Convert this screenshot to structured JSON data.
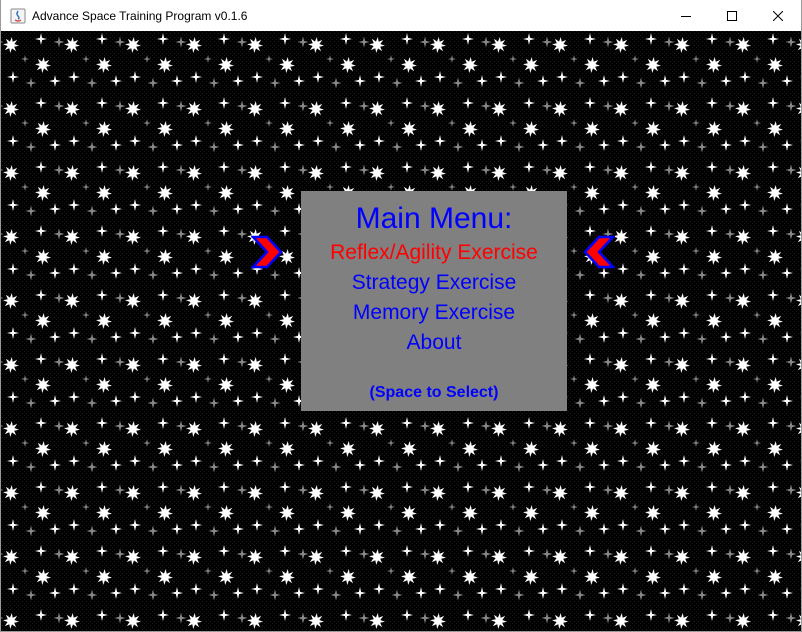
{
  "window": {
    "title": "Advance Space Training Program v0.1.6",
    "icon": "java-app-icon",
    "controls": [
      "minimize-icon",
      "maximize-icon",
      "close-icon"
    ]
  },
  "background": {
    "pattern": "tiled starfield",
    "color": "#000000",
    "star_color_bright": "#ffffff",
    "star_color_dim": "#888888"
  },
  "menu": {
    "title": "Main Menu:",
    "items": [
      {
        "label": "Reflex/Agility Exercise",
        "selected": true
      },
      {
        "label": "Strategy Exercise",
        "selected": false
      },
      {
        "label": "Memory Exercise",
        "selected": false
      },
      {
        "label": "About",
        "selected": false
      }
    ],
    "hint": "(Space to Select)",
    "panel_color": "#808080",
    "text_color": "#0000ff",
    "selected_color": "#ff0000"
  },
  "selector": {
    "icon_left": "chevron-right-icon",
    "icon_right": "chevron-left-icon",
    "fill_color": "#ff0000",
    "outline_color": "#0000ff"
  }
}
